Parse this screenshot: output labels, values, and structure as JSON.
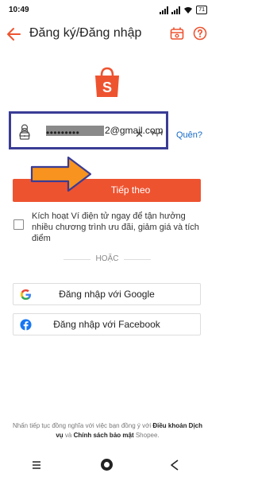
{
  "status_bar": {
    "time": "10:49",
    "battery": "71"
  },
  "header": {
    "title": "Đăng ký/Đăng nhập"
  },
  "form": {
    "email_value": "2@gmail.com",
    "password_value": "•••••••••",
    "forgot_label": "Quên?"
  },
  "continue_button": {
    "label": "Tiếp theo"
  },
  "wallet_checkbox": {
    "text": "Kích hoạt Ví điện tử ngay để tận hưởng nhiều chương trình ưu đãi, giảm giá và tích điểm",
    "checked": false
  },
  "divider": {
    "or_label": "HOẶC"
  },
  "social": {
    "google_label": "Đăng nhập với Google",
    "facebook_label": "Đăng nhập với Facebook"
  },
  "footer": {
    "prefix": "Nhấn tiếp tục đồng nghĩa với việc bạn đồng ý với ",
    "terms": "Điều khoản Dịch vụ",
    "and": " và ",
    "privacy": "Chính sách bảo mật",
    "suffix": " Shopee."
  },
  "colors": {
    "brand": "#ee5330",
    "highlight_box": "#3a3c95",
    "arrow": "#f7931e",
    "link": "#1569c7"
  },
  "icons": {
    "back": "arrow-left-icon",
    "promo": "voucher-icon",
    "help": "question-icon",
    "logo": "shopee-bag-icon",
    "user": "user-icon",
    "lock": "lock-icon",
    "clear": "close-icon",
    "toggle_password": "eye-closed-icon",
    "google": "google-icon",
    "facebook": "facebook-icon"
  }
}
